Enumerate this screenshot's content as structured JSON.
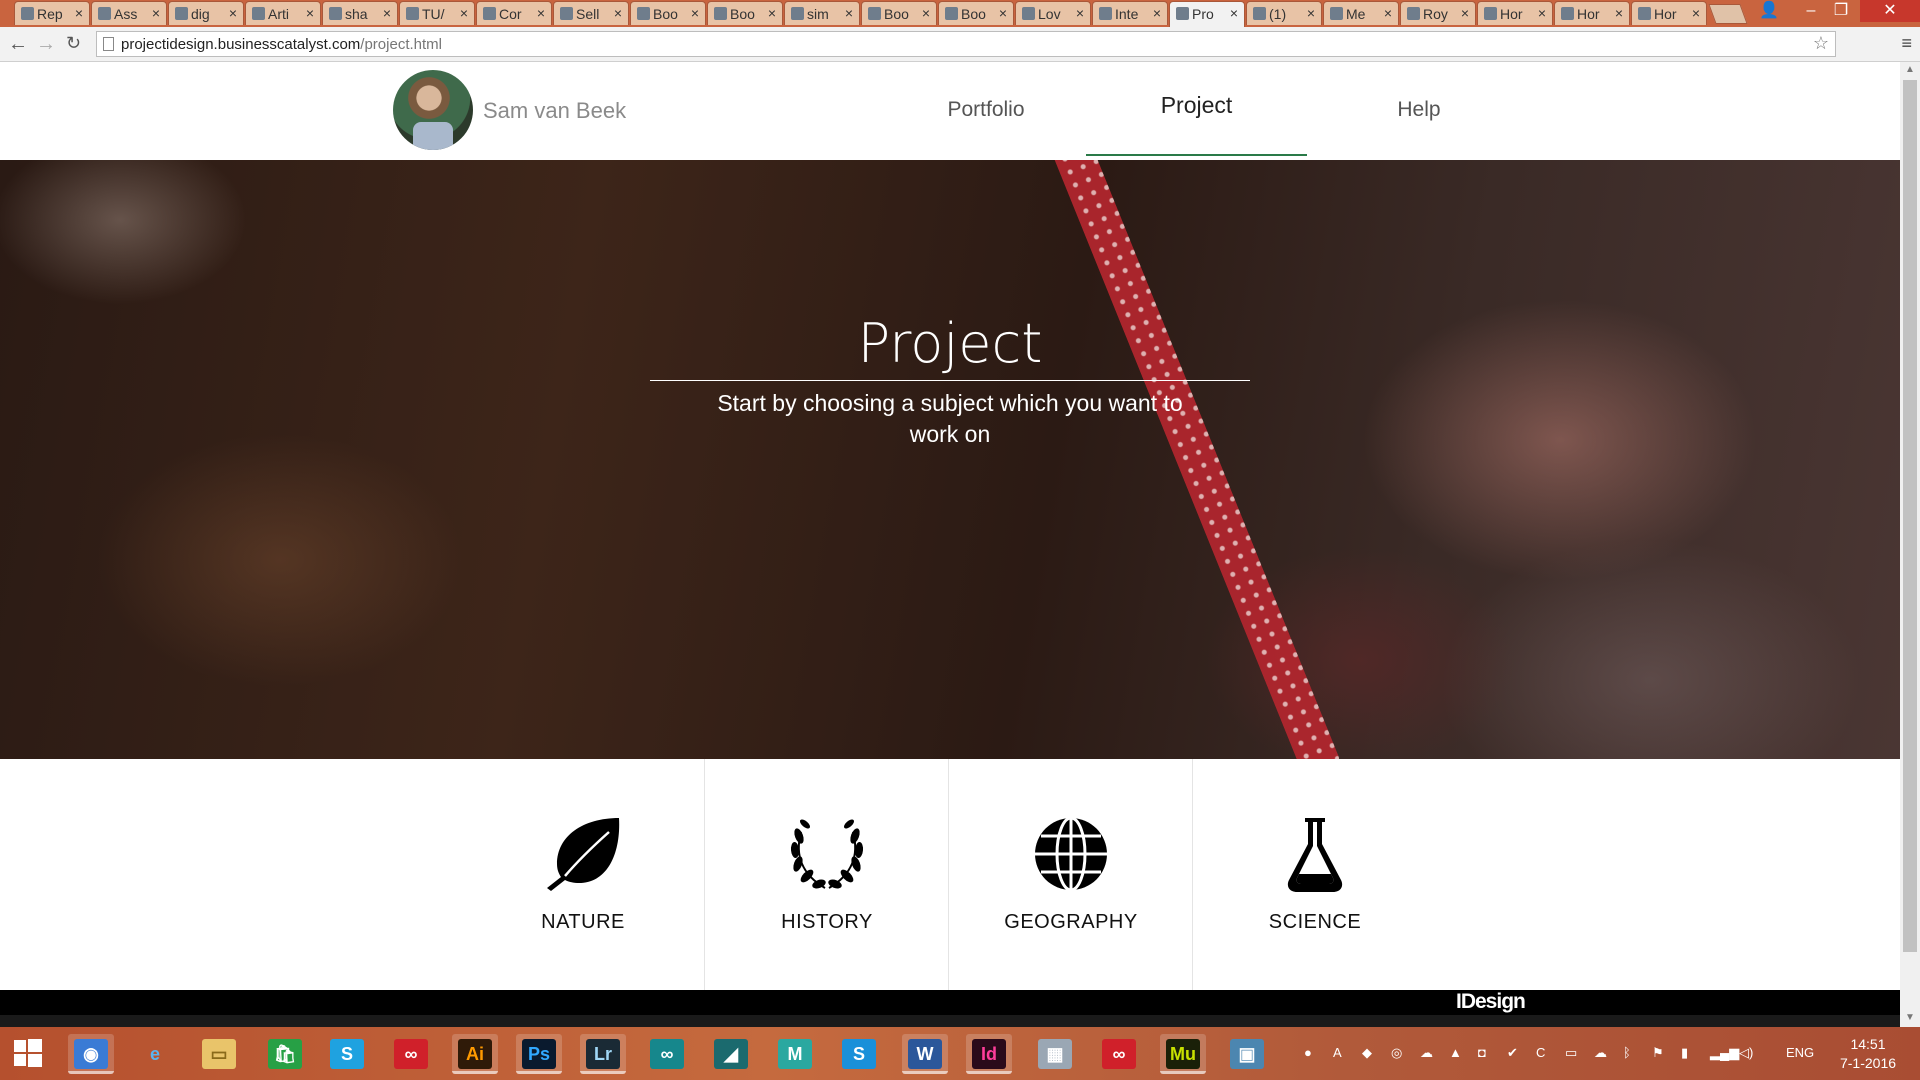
{
  "browser": {
    "tabs": [
      "Rep",
      "Ass",
      "dig",
      "Arti",
      "sha",
      "TU/",
      "Cor",
      "Sell",
      "Boo",
      "Boo",
      "sim",
      "Boo",
      "Boo",
      "Lov",
      "Inte",
      "Pro",
      "(1)",
      "Me",
      "Roy",
      "Hor",
      "Hor",
      "Hor"
    ],
    "active_tab_index": 15,
    "url_host": "projectidesign.businesscatalyst.com",
    "url_path": "/project.html"
  },
  "site": {
    "owner_name": "Sam van Beek",
    "nav": [
      "Portfolio",
      "Project",
      "Help"
    ],
    "active_nav": "Project"
  },
  "hero": {
    "title": "Project",
    "subtitle_line1": "Start by choosing a subject which you want to",
    "subtitle_line2": "work on"
  },
  "subjects": [
    {
      "label": "NATURE",
      "icon": "leaf-icon"
    },
    {
      "label": "HISTORY",
      "icon": "laurel-wreath-icon"
    },
    {
      "label": "GEOGRAPHY",
      "icon": "globe-icon"
    },
    {
      "label": "SCIENCE",
      "icon": "flask-icon"
    }
  ],
  "footer": {
    "brand": "IDesign"
  },
  "taskbar": {
    "apps": [
      "chrome",
      "internet-explorer",
      "file-explorer",
      "store",
      "skype",
      "creative-cloud",
      "Ai",
      "Ps",
      "Lr",
      "arduino",
      "3ds-max",
      "maya",
      "skype-business",
      "W",
      "Id",
      "calculator",
      "creative-cloud-2",
      "Mu",
      "photos"
    ],
    "language": "ENG",
    "time": "14:51",
    "date": "7-1-2016"
  }
}
